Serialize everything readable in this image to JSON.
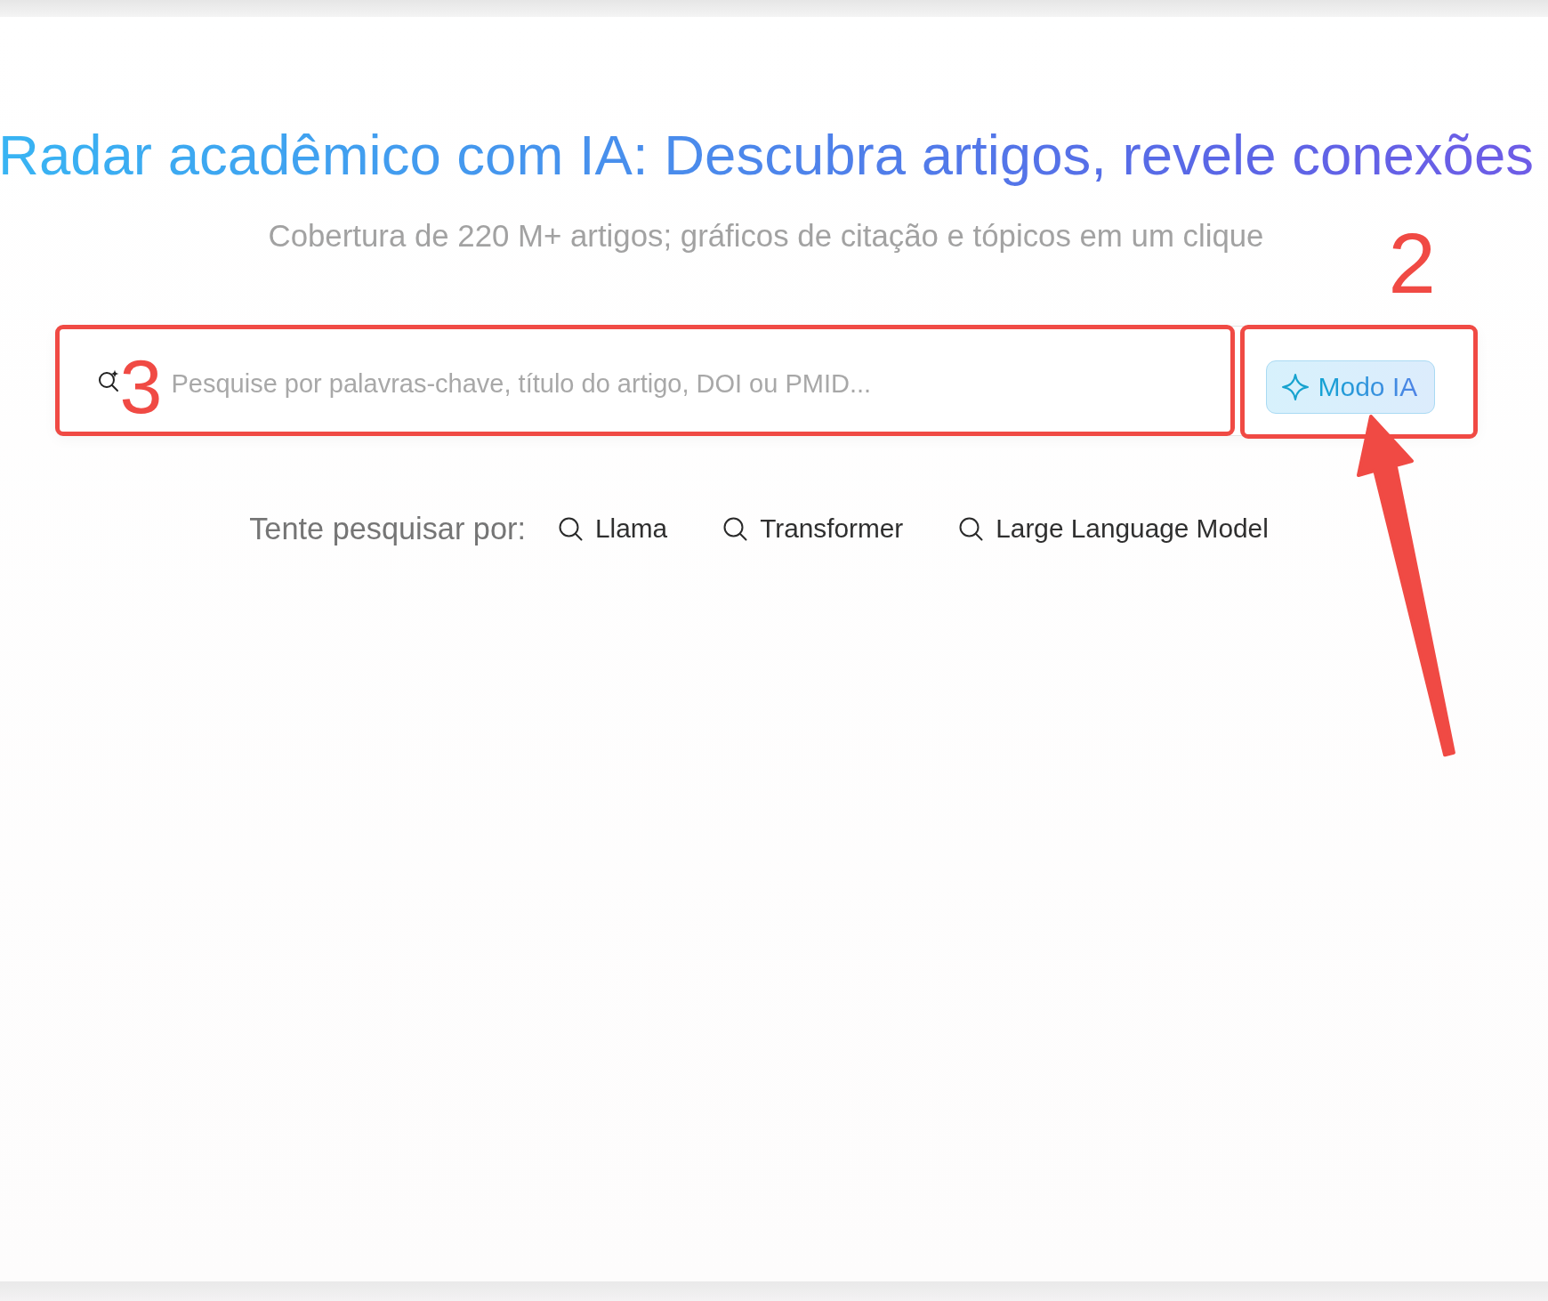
{
  "header": {
    "title": "Radar acadêmico com IA: Descubra artigos, revele conexões",
    "subtitle": "Cobertura de 220 M+ artigos; gráficos de citação e tópicos em um clique"
  },
  "search": {
    "placeholder": "Pesquise por palavras-chave, título do artigo, DOI ou PMID...",
    "marker": "3",
    "ai_button": {
      "label": "Modo IA",
      "marker": "2",
      "arrow": true
    }
  },
  "suggestions": {
    "label": "Tente pesquisar por:",
    "items": [
      "Llama",
      "Transformer",
      "Large Language Model"
    ]
  }
}
